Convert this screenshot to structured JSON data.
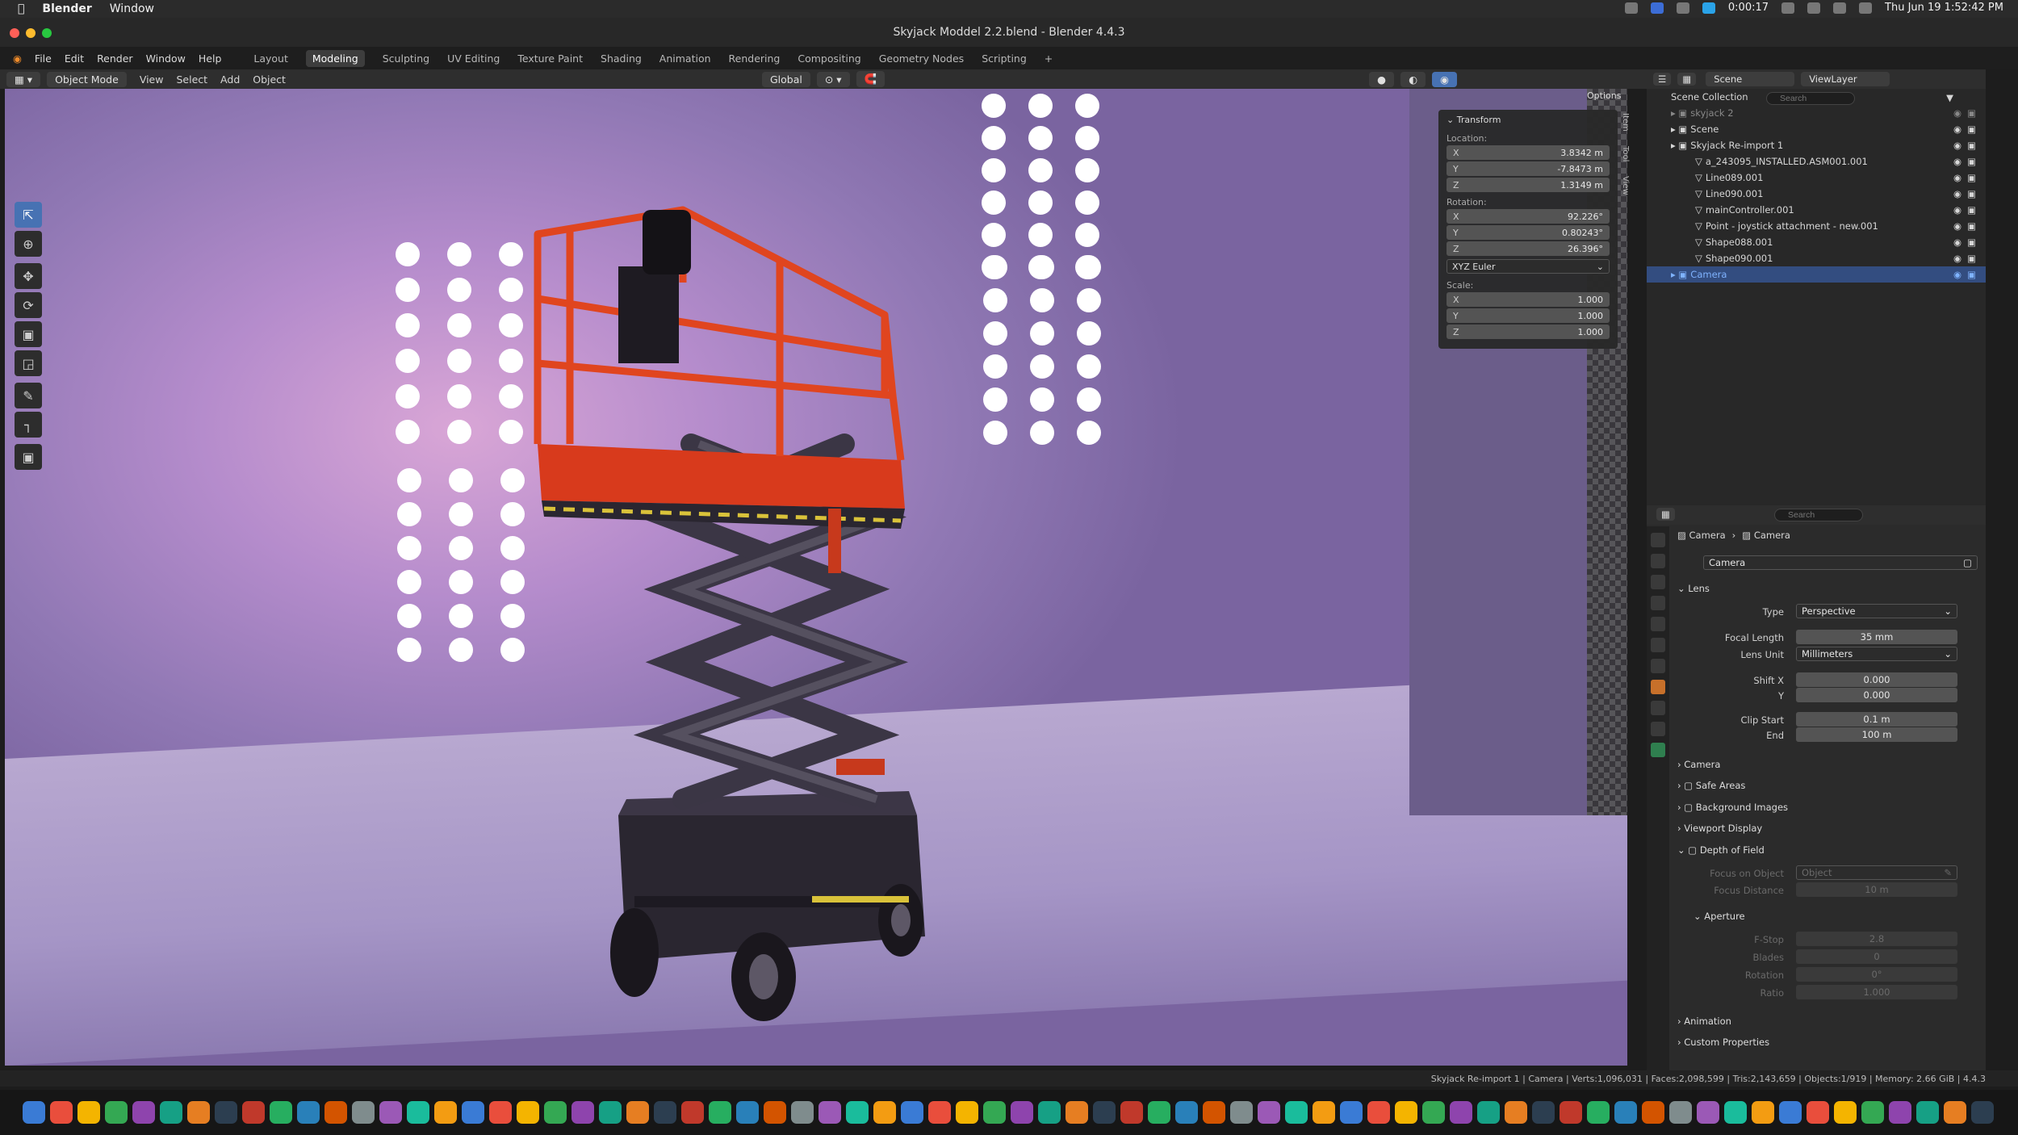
{
  "macbar": {
    "app": "Blender",
    "window_menu": "Window",
    "timer": "0:00:17",
    "clock": "Thu Jun 19  1:52:42 PM"
  },
  "title": "Skyjack Moddel 2.2.blend - Blender 4.4.3",
  "menus": [
    "File",
    "Edit",
    "Render",
    "Window",
    "Help"
  ],
  "workspaces": [
    "Layout",
    "Modeling",
    "Sculpting",
    "UV Editing",
    "Texture Paint",
    "Shading",
    "Animation",
    "Rendering",
    "Compositing",
    "Geometry Nodes",
    "Scripting"
  ],
  "viewport_header": {
    "mode": "Object Mode",
    "view": "View",
    "select": "Select",
    "add": "Add",
    "object": "Object",
    "orientation": "Global",
    "options": "Options"
  },
  "transform": {
    "header": "Transform",
    "location_label": "Location:",
    "location": [
      {
        "axis": "X",
        "value": "3.8342 m"
      },
      {
        "axis": "Y",
        "value": "-7.8473 m"
      },
      {
        "axis": "Z",
        "value": "1.3149 m"
      }
    ],
    "rotation_label": "Rotation:",
    "rotation": [
      {
        "axis": "X",
        "value": "92.226°"
      },
      {
        "axis": "Y",
        "value": "0.80243°"
      },
      {
        "axis": "Z",
        "value": "26.396°"
      }
    ],
    "rotation_mode": "XYZ Euler",
    "scale_label": "Scale:",
    "scale": [
      {
        "axis": "X",
        "value": "1.000"
      },
      {
        "axis": "Y",
        "value": "1.000"
      },
      {
        "axis": "Z",
        "value": "1.000"
      }
    ]
  },
  "side_tabs": [
    "Item",
    "Tool",
    "View"
  ],
  "outliner": {
    "scene": "Scene",
    "view_layer": "ViewLayer",
    "search_placeholder": "Search",
    "root": "Scene Collection",
    "items": [
      {
        "name": "skyjack 2",
        "indent": 1,
        "dim": true
      },
      {
        "name": "Scene",
        "indent": 1
      },
      {
        "name": "Skyjack Re-import 1",
        "indent": 1
      },
      {
        "name": "a_243095_INSTALLED.ASM001.001",
        "indent": 2
      },
      {
        "name": "Line089.001",
        "indent": 2
      },
      {
        "name": "Line090.001",
        "indent": 2
      },
      {
        "name": "mainController.001",
        "indent": 2
      },
      {
        "name": "Point - joystick attachment - new.001",
        "indent": 2
      },
      {
        "name": "Shape088.001",
        "indent": 2
      },
      {
        "name": "Shape090.001",
        "indent": 2
      },
      {
        "name": "Camera",
        "indent": 1,
        "selected": true
      }
    ]
  },
  "properties": {
    "search_placeholder": "Search",
    "breadcrumb": [
      "Camera",
      "Camera"
    ],
    "data_name": "Camera",
    "lens_header": "Lens",
    "type_label": "Type",
    "type_value": "Perspective",
    "focal_label": "Focal Length",
    "focal_value": "35 mm",
    "lens_unit_label": "Lens Unit",
    "lens_unit_value": "Millimeters",
    "shift_x_label": "Shift X",
    "shift_x_value": "0.000",
    "shift_y_label": "Y",
    "shift_y_value": "0.000",
    "clip_start_label": "Clip Start",
    "clip_start_value": "0.1 m",
    "clip_end_label": "End",
    "clip_end_value": "100 m",
    "sections": [
      "Camera",
      "Safe Areas",
      "Background Images",
      "Viewport Display",
      "Depth of Field"
    ],
    "focus_object_label": "Focus on Object",
    "focus_object_placeholder": "Object",
    "focus_distance_label": "Focus Distance",
    "focus_distance_value": "10 m",
    "aperture_header": "Aperture",
    "fstop_label": "F-Stop",
    "fstop_value": "2.8",
    "blades_label": "Blades",
    "blades_value": "0",
    "rotation_label": "Rotation",
    "rotation_value": "0°",
    "ratio_label": "Ratio",
    "ratio_value": "1.000",
    "animation": "Animation",
    "custom_props": "Custom Properties"
  },
  "status": "Skyjack Re-import 1 | Camera | Verts:1,096,031 | Faces:2,098,599 | Tris:2,143,659 | Objects:1/919 | Memory: 2.66 GiB | 4.4.3",
  "colors": {
    "accent": "#4772b3",
    "lift_red": "#d83a1c",
    "backdrop": "#b58ccc"
  }
}
